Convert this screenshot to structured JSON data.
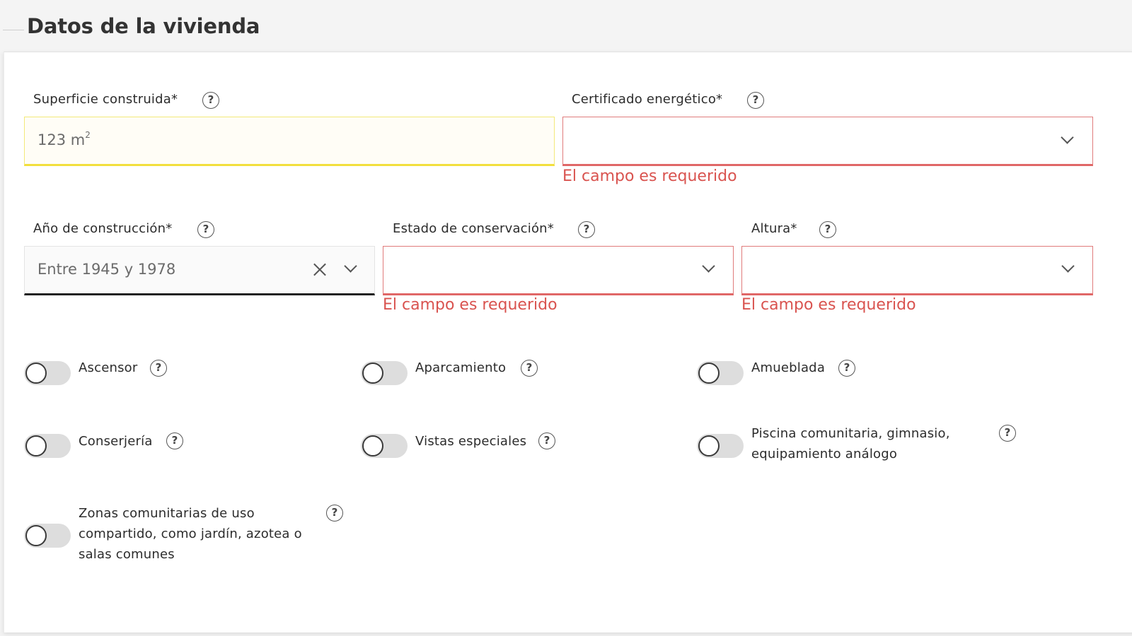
{
  "page": {
    "title": "Datos de la vivienda"
  },
  "fields": {
    "superficie": {
      "label": "Superficie construida*",
      "value": "123 m",
      "unit_sup": "2"
    },
    "certificado": {
      "label": "Certificado energético*",
      "value": "",
      "error": "El campo es requerido"
    },
    "anio": {
      "label": "Año de construcción*",
      "value": "Entre 1945 y 1978"
    },
    "estado": {
      "label": "Estado de conservación*",
      "value": "",
      "error": "El campo es requerido"
    },
    "altura": {
      "label": "Altura*",
      "value": "",
      "error": "El campo es requerido"
    }
  },
  "help_glyph": "?",
  "toggles": [
    {
      "label": "Ascensor",
      "on": false
    },
    {
      "label": "Aparcamiento",
      "on": false
    },
    {
      "label": "Amueblada",
      "on": false
    },
    {
      "label": "Conserjería",
      "on": false
    },
    {
      "label": "Vistas especiales",
      "on": false
    },
    {
      "label": "Piscina comunitaria, gimnasio, equipamiento análogo",
      "on": false
    },
    {
      "label": "Zonas comunitarias de uso compartido, como jardín, azotea o salas comunes",
      "on": false
    }
  ],
  "colors": {
    "error": "#d9534f",
    "focus_yellow": "#f2df3c",
    "toggle_off": "#dddddd"
  },
  "icons": {
    "help": "question-circle-icon",
    "dropdown": "chevron-down-icon",
    "clear": "close-icon"
  }
}
